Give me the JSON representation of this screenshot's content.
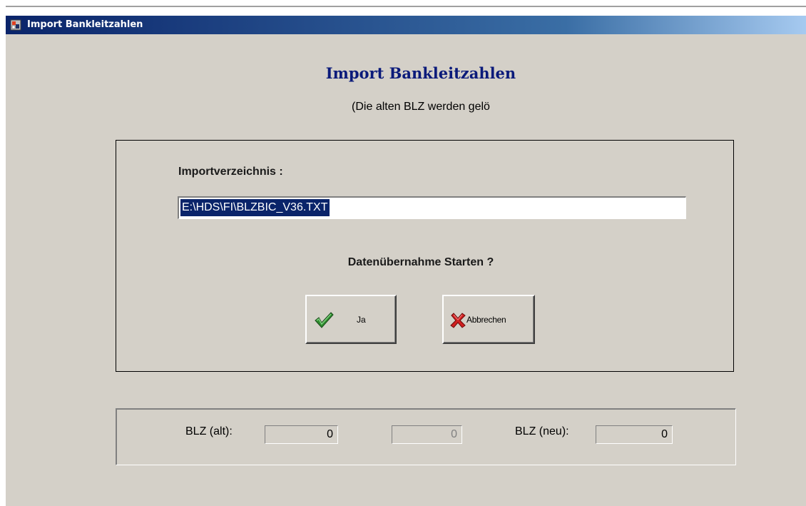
{
  "window": {
    "title": "Import Bankleitzahlen",
    "icon": "app-icon"
  },
  "header": {
    "heading": "Import Bankleitzahlen",
    "subheading": "(Die alten BLZ werden gelö"
  },
  "import": {
    "label": "Importverzeichnis :",
    "path_value": "E:\\HDS\\FI\\BLZBIC_V36.TXT"
  },
  "confirm": {
    "question": "Datenübernahme Starten ?",
    "yes_label": "Ja",
    "yes_icon": "checkmark-icon",
    "cancel_label": "Abbrechen",
    "cancel_icon": "red-x-icon"
  },
  "status": {
    "alt_label": "BLZ (alt):",
    "alt_value": "0",
    "mid_value": "0",
    "neu_label": "BLZ (neu):",
    "neu_value": "0"
  },
  "colors": {
    "title_gradient_start": "#0a246a",
    "heading": "#0a1a7a",
    "selection": "#0a246a",
    "dialog_bg": "#d4d0c8"
  }
}
